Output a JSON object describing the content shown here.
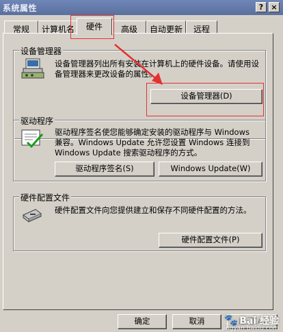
{
  "window": {
    "title": "系统属性",
    "help_btn": "?",
    "close_btn": "×"
  },
  "tabs": [
    {
      "label": "常规"
    },
    {
      "label": "计算机名"
    },
    {
      "label": "硬件",
      "active": true
    },
    {
      "label": "高级"
    },
    {
      "label": "自动更新"
    },
    {
      "label": "远程"
    }
  ],
  "groups": {
    "device_manager": {
      "title": "设备管理器",
      "description": "设备管理器列出所有安装在计算机上的硬件设备。请使用设备管理器来更改设备的属性。",
      "button": "设备管理器(D)"
    },
    "drivers": {
      "title": "驱动程序",
      "description": "驱动程序签名使您能够确定安装的驱动程序与 Windows 兼容。Windows Update 允许您设置 Windows 连接到 Windows Update 搜索驱动程序的方式。",
      "button_signing": "驱动程序签名(S)",
      "button_update": "Windows Update(W)"
    },
    "hw_profiles": {
      "title": "硬件配置文件",
      "description": "硬件配置文件向您提供建立和保存不同硬件配置的方法。",
      "button": "硬件配置文件(P)"
    }
  },
  "footer": {
    "ok": "确定",
    "cancel": "取消",
    "apply": "应用(A)"
  },
  "watermark": {
    "brand": "Bai 经验",
    "url": "jingyan.baidu.com"
  },
  "colors": {
    "highlight": "#e53030",
    "face": "#d4d0c8"
  }
}
